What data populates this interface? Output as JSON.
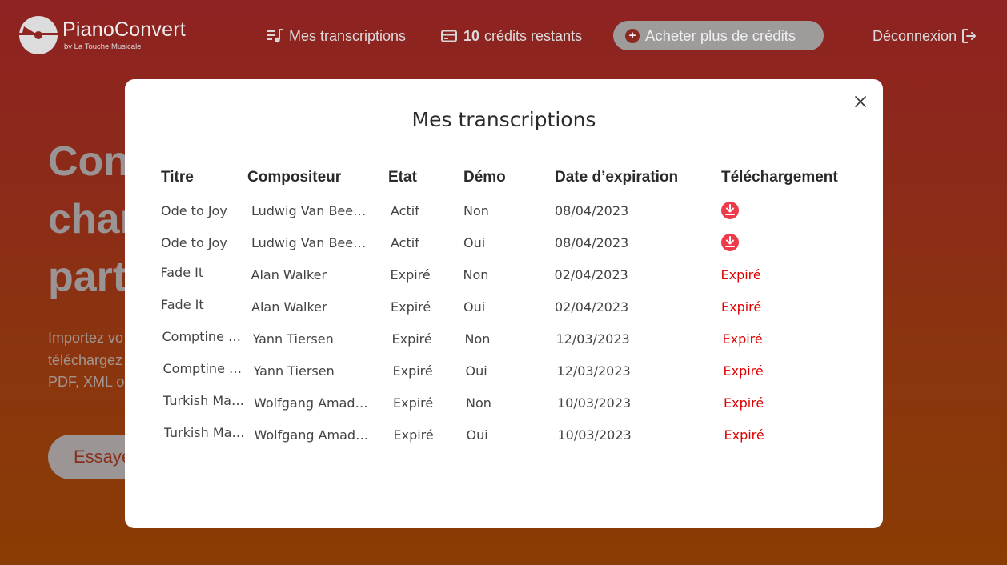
{
  "header": {
    "brand_name": "PianoConvert",
    "brand_sub": "by La Touche Musicale",
    "nav_transcriptions": "Mes transcriptions",
    "credits_count": "10",
    "credits_label": "crédits restants",
    "buy_label": "Acheter plus de crédits",
    "logout_label": "Déconnexion"
  },
  "hero": {
    "line1": "Con",
    "line2": "char",
    "line3": "part",
    "sub1": "Importez vo",
    "sub2": "téléchargez",
    "sub3": "PDF, XML o",
    "cta": "Essayer"
  },
  "modal": {
    "title": "Mes transcriptions",
    "columns": {
      "title": "Titre",
      "composer": "Compositeur",
      "state": "Etat",
      "demo": "Démo",
      "expiry": "Date d’expiration",
      "download": "Téléchargement"
    },
    "rows": [
      {
        "title": "Ode to Joy",
        "composer": "Ludwig Van Beethoven",
        "state": "Actif",
        "demo": "Non",
        "expiry": "08/04/2023",
        "download": "",
        "downloadable": true
      },
      {
        "title": "Ode to Joy",
        "composer": "Ludwig Van Beethoven",
        "state": "Actif",
        "demo": "Oui",
        "expiry": "08/04/2023",
        "download": "",
        "downloadable": true
      },
      {
        "title": "Fade It",
        "composer": "Alan Walker",
        "state": "Expiré",
        "demo": "Non",
        "expiry": "02/04/2023",
        "download": "Expiré",
        "downloadable": false
      },
      {
        "title": "Fade It",
        "composer": "Alan Walker",
        "state": "Expiré",
        "demo": "Oui",
        "expiry": "02/04/2023",
        "download": "Expiré",
        "downloadable": false
      },
      {
        "title": "Comptine d'un autre été",
        "composer": "Yann Tiersen",
        "state": "Expiré",
        "demo": "Non",
        "expiry": "12/03/2023",
        "download": "Expiré",
        "downloadable": false
      },
      {
        "title": "Comptine d'un autre été",
        "composer": "Yann Tiersen",
        "state": "Expiré",
        "demo": "Oui",
        "expiry": "12/03/2023",
        "download": "Expiré",
        "downloadable": false
      },
      {
        "title": "Turkish March",
        "composer": "Wolfgang Amadeus Mozart",
        "state": "Expiré",
        "demo": "Non",
        "expiry": "10/03/2023",
        "download": "Expiré",
        "downloadable": false
      },
      {
        "title": "Turkish March",
        "composer": "Wolfgang Amadeus Mozart",
        "state": "Expiré",
        "demo": "Oui",
        "expiry": "10/03/2023",
        "download": "Expiré",
        "downloadable": false
      }
    ]
  },
  "colors": {
    "expired": "#e00000",
    "download_icon": "#ee3b4a",
    "buy_button": "#9e9b9b"
  },
  "icons": {
    "transcriptions": "music-list-icon",
    "credits": "credit-card-icon",
    "buy": "plus-circle-icon",
    "logout": "logout-icon",
    "close": "close-icon",
    "download": "download-icon"
  }
}
